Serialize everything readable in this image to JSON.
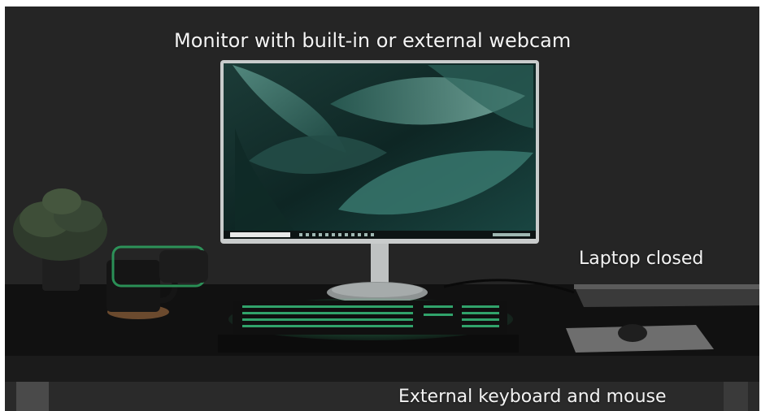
{
  "annotations": {
    "monitor": "Monitor with built-in or external webcam",
    "laptop": "Laptop closed",
    "peripherals": "External keyboard and mouse"
  },
  "colors": {
    "wall": "#252525",
    "desk": "#121212",
    "caption_text": "#f3f3f3",
    "screen_leaf": "#2f6b63",
    "keyboard_glow": "#3cd48a"
  },
  "icons": [
    "plant-icon",
    "mug-icon",
    "monitor-icon",
    "keyboard-icon",
    "mouse-icon",
    "laptop-icon"
  ]
}
